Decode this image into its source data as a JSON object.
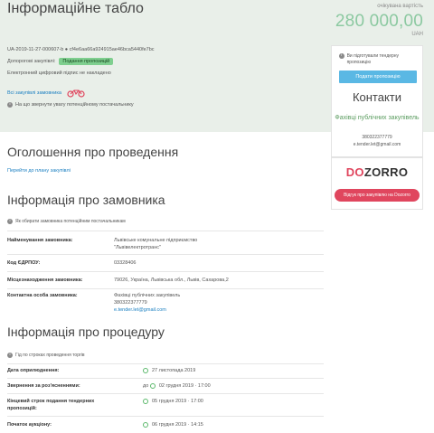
{
  "header": {
    "title": "Інформаційне табло",
    "amount_label": "очікувана вартість",
    "amount": "280 000,00",
    "currency": "UAH",
    "tender_id": "UA-2019-11-27-000607-b ● cf4e6aa66a924915ae46bca5440fe7bc",
    "procurement_type_label": "Допорогові закупівлі:",
    "status_badge": "Подання пропозицій",
    "ecp_text": "Електронний цифровий підпис не накладено",
    "all_purchases_link": "Всі закупівлі замовника",
    "attention_text": "На що звернути увагу потенційному постачальнику"
  },
  "side": {
    "not_ready_text": "Ви підготували тендерну пропозицію",
    "submit_button": "Подати пропозицію",
    "contacts_title": "Контакти",
    "contact_name": "Фахівці публічних закупівель",
    "contact_phone": "380322377779",
    "contact_email": "e.tender.let@gmail.com"
  },
  "dozorro": {
    "logo_part1": "DO",
    "logo_part2": "ZORRO",
    "feedback_button": "Відгук про закупівлю на Dozorro"
  },
  "announcement": {
    "title": "Оголошення про проведення",
    "link": "Перейти до плану закупівлі"
  },
  "customer": {
    "title": "Інформація про замовника",
    "note": "Як обирати замовника потенційним постачальникам",
    "rows": [
      {
        "label": "Найменування замовника:",
        "value": "Львівське комунальне підприємство \"Львівелектротранс\""
      },
      {
        "label": "Код ЄДРПОУ:",
        "value": "03328406"
      },
      {
        "label": "Місцезнаходження замовника:",
        "value": "79026, Україна, Львівська обл., Львів, Сахарова,2"
      },
      {
        "label": "Контактна особа замовника:",
        "value": "Фахівці публічних закупівель",
        "phone": "380322377779",
        "email": "e.tender.let@gmail.com"
      }
    ]
  },
  "procedure": {
    "title": "Інформація про процедуру",
    "note": "Гід по строках проведення торгів",
    "rows": [
      {
        "label": "Дата оприлюднення:",
        "value": "27 листопада 2019"
      },
      {
        "label": "Звернення за роз'ясненнями:",
        "prefix": "до",
        "value": "02 грудня 2019 · 17:00"
      },
      {
        "label": "Кінцевий строк подання тендерних пропозицій:",
        "value": "05 грудня 2019 · 17:00"
      },
      {
        "label": "Початок аукціону:",
        "value": "06 грудня 2019 · 14:15"
      }
    ]
  }
}
